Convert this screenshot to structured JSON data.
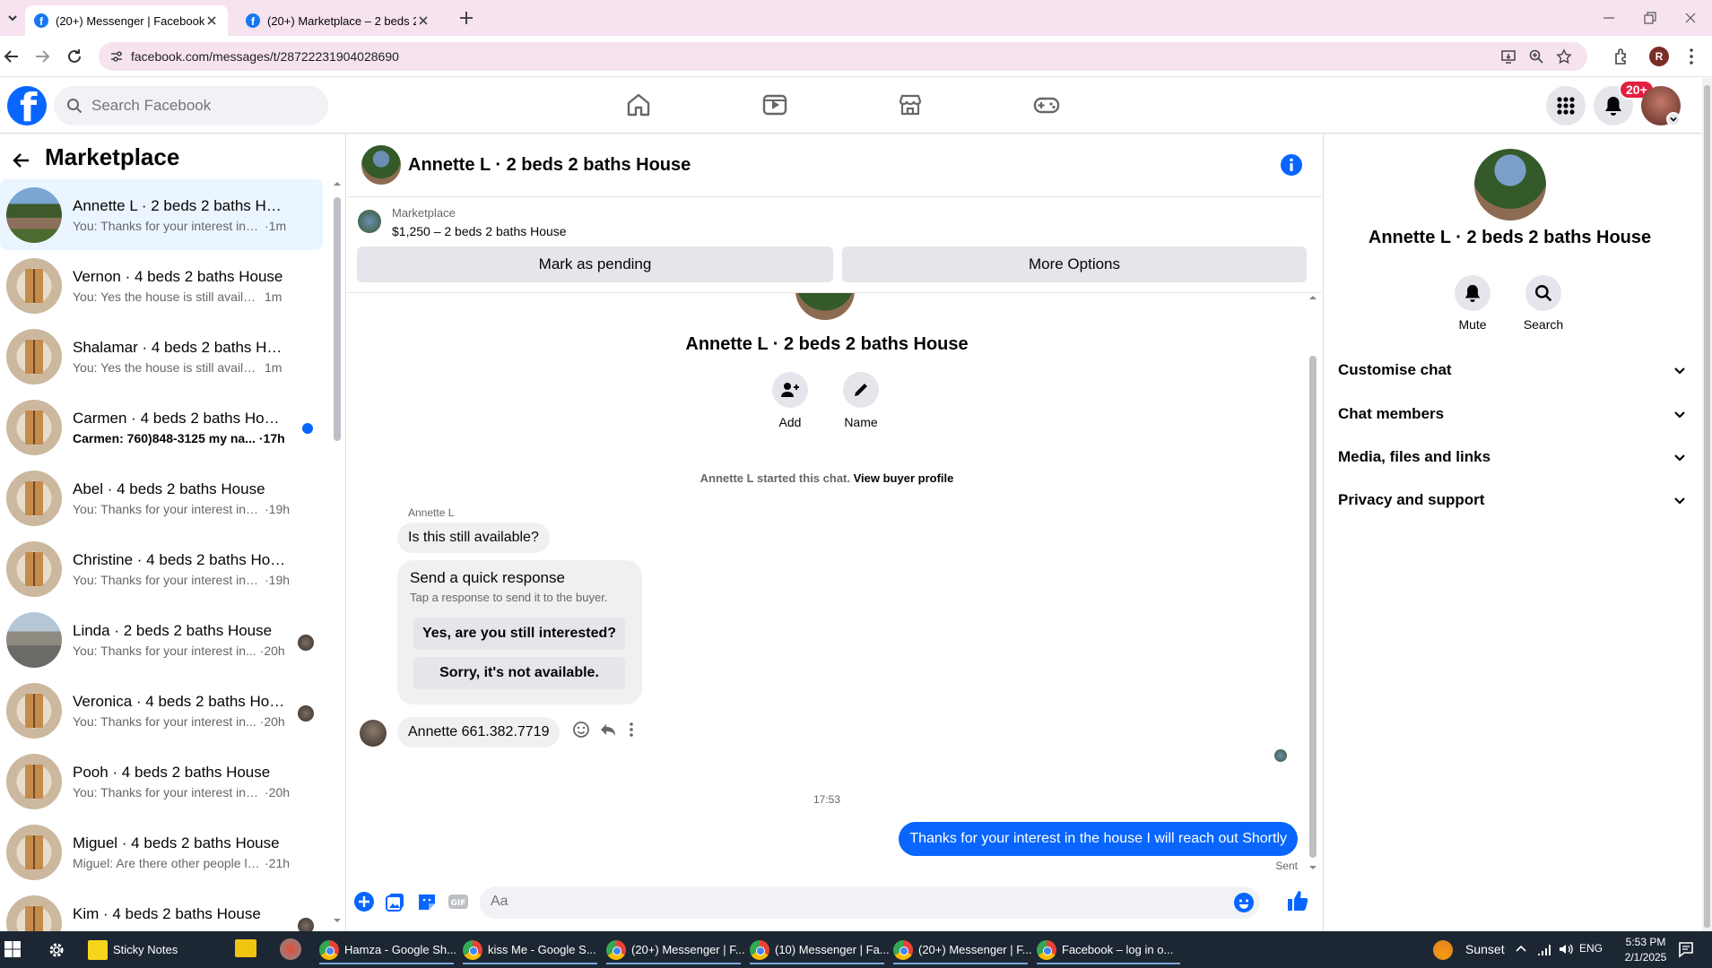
{
  "browser": {
    "tabs": [
      {
        "label": "(20+) Messenger | Facebook",
        "active": true
      },
      {
        "label": "(20+) Marketplace – 2 beds 2 b",
        "active": false
      }
    ],
    "url": "facebook.com/messages/t/28722231904028690",
    "profile_initial": "R"
  },
  "fb": {
    "search_placeholder": "Search Facebook",
    "notif_badge": "20+"
  },
  "sidebar": {
    "title": "Marketplace",
    "chats": [
      {
        "name": "Annette L · 2 beds 2 baths House",
        "text": "You: Thanks for your interest in th...",
        "time": "·1m",
        "avatar": "house"
      },
      {
        "name": "Vernon · 4 beds 2 baths House",
        "text": "You: Yes the house is still available ...",
        "time": "1m",
        "avatar": "door"
      },
      {
        "name": "Shalamar · 4 beds 2 baths House",
        "text": "You: Yes the house is still available ...",
        "time": "1m",
        "avatar": "door"
      },
      {
        "name": "Carmen · 4 beds 2 baths House",
        "text": "Carmen: 760)848-3125 my na...",
        "time": "·17h",
        "avatar": "door",
        "unread": true
      },
      {
        "name": "Abel · 4 beds 2 baths House",
        "text": "You: Thanks for your interest in th...",
        "time": "·19h",
        "avatar": "door"
      },
      {
        "name": "Christine · 4 beds 2 baths House",
        "text": "You: Thanks for your interest in th...",
        "time": "·19h",
        "avatar": "door"
      },
      {
        "name": "Linda · 2 beds 2 baths House",
        "text": "You: Thanks for your interest in...",
        "time": "·20h",
        "avatar": "street",
        "seen": true
      },
      {
        "name": "Veronica · 4 beds 2 baths Hou...",
        "text": "You: Thanks for your interest in...",
        "time": "·20h",
        "avatar": "door",
        "seen": true
      },
      {
        "name": "Pooh · 4 beds 2 baths House",
        "text": "You: Thanks for your interest in th...",
        "time": "·20h",
        "avatar": "door"
      },
      {
        "name": "Miguel · 4 beds 2 baths House",
        "text": "Miguel: Are there other people liv...",
        "time": "·21h",
        "avatar": "door"
      },
      {
        "name": "Kim · 4 beds 2 baths House",
        "text": "",
        "time": "",
        "avatar": "door",
        "seen": true
      }
    ]
  },
  "conversation": {
    "title": "Annette L · 2 beds 2 baths House",
    "marketplace_label": "Marketplace",
    "listing": "$1,250 – 2 beds 2 baths House",
    "mark_pending": "Mark as pending",
    "more_options": "More Options",
    "thread_name": "Annette L · 2 beds 2 baths House",
    "add_label": "Add",
    "name_label": "Name",
    "started_text": "Annette L started this chat.",
    "view_buyer": "View buyer profile",
    "sender": "Annette L",
    "msg1": "Is this still available?",
    "quick_title": "Send a quick response",
    "quick_sub": "Tap a response to send it to the buyer.",
    "quick_opt1": "Yes, are you still interested?",
    "quick_opt2": "Sorry, it's not available.",
    "msg2": "Annette 661.382.7719",
    "time": "17:53",
    "msg_out": "Thanks for your interest in the house I will reach out Shortly",
    "sent_label": "Sent",
    "composer_placeholder": "Aa"
  },
  "info_panel": {
    "name": "Annette L · 2 beds 2 baths House",
    "mute": "Mute",
    "search": "Search",
    "sections": [
      "Customise chat",
      "Chat members",
      "Media, files and links",
      "Privacy and support"
    ]
  },
  "taskbar": {
    "items": [
      {
        "label": "Sticky Notes",
        "icon": "sticky"
      },
      {
        "label": "Hamza - Google Sh...",
        "icon": "chrome"
      },
      {
        "label": "kiss Me - Google S...",
        "icon": "chrome"
      },
      {
        "label": "(20+) Messenger | F...",
        "icon": "chrome"
      },
      {
        "label": "(10) Messenger | Fa...",
        "icon": "chrome"
      },
      {
        "label": "(20+) Messenger | F...",
        "icon": "chrome"
      },
      {
        "label": "Facebook – log in o...",
        "icon": "chrome"
      }
    ],
    "weather": "Sunset",
    "lang": "ENG",
    "clock_time": "5:53 PM",
    "clock_date": "2/1/2025"
  },
  "colors": {
    "fb_blue": "#0866ff",
    "bubble_gray": "#f0f0f0",
    "active_chat": "#ebf5ff",
    "badge_red": "#e41e3f"
  }
}
